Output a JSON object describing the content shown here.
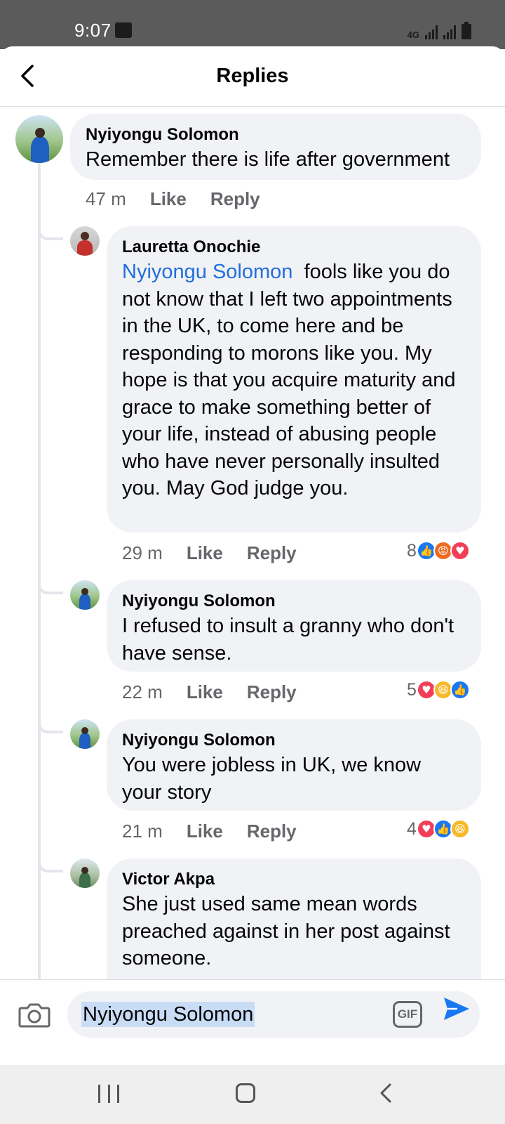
{
  "status_bar": {
    "time": "9:07",
    "network": "4G"
  },
  "header": {
    "title": "Replies"
  },
  "comments": [
    {
      "author": "Nyiyongu Solomon",
      "text": "Remember there is life after government",
      "time": "47 m",
      "like": "Like",
      "reply": "Reply"
    },
    {
      "author": "Lauretta Onochie",
      "mention": "Nyiyongu Solomon",
      "text": "fools like you do not know that I left two appointments in the UK, to come here and be responding to  morons like you. My hope is that you acquire maturity and grace to make something better of your life, instead of abusing people who have never personally insulted you. May God judge you.",
      "time": "29 m",
      "like": "Like",
      "reply": "Reply",
      "reaction_count": "8",
      "reactions": [
        "like",
        "angry",
        "love"
      ]
    },
    {
      "author": "Nyiyongu Solomon",
      "text": "I refused to insult a granny who don't have sense.",
      "time": "22 m",
      "like": "Like",
      "reply": "Reply",
      "reaction_count": "5",
      "reactions": [
        "love",
        "haha",
        "like"
      ]
    },
    {
      "author": "Nyiyongu Solomon",
      "text": "You were jobless in UK, we know your story",
      "time": "21 m",
      "like": "Like",
      "reply": "Reply",
      "reaction_count": "4",
      "reactions": [
        "love",
        "like",
        "haha"
      ]
    },
    {
      "author": "Victor Akpa",
      "text": "She just used same mean words preached against in her post against someone."
    }
  ],
  "composer": {
    "value": "Nyiyongu Solomon",
    "gif_label": "GIF"
  },
  "colors": {
    "mention": "#216fdb",
    "like": "#1877f2",
    "love": "#f33e58",
    "angry": "#f06b22",
    "haha": "#f7b928"
  }
}
